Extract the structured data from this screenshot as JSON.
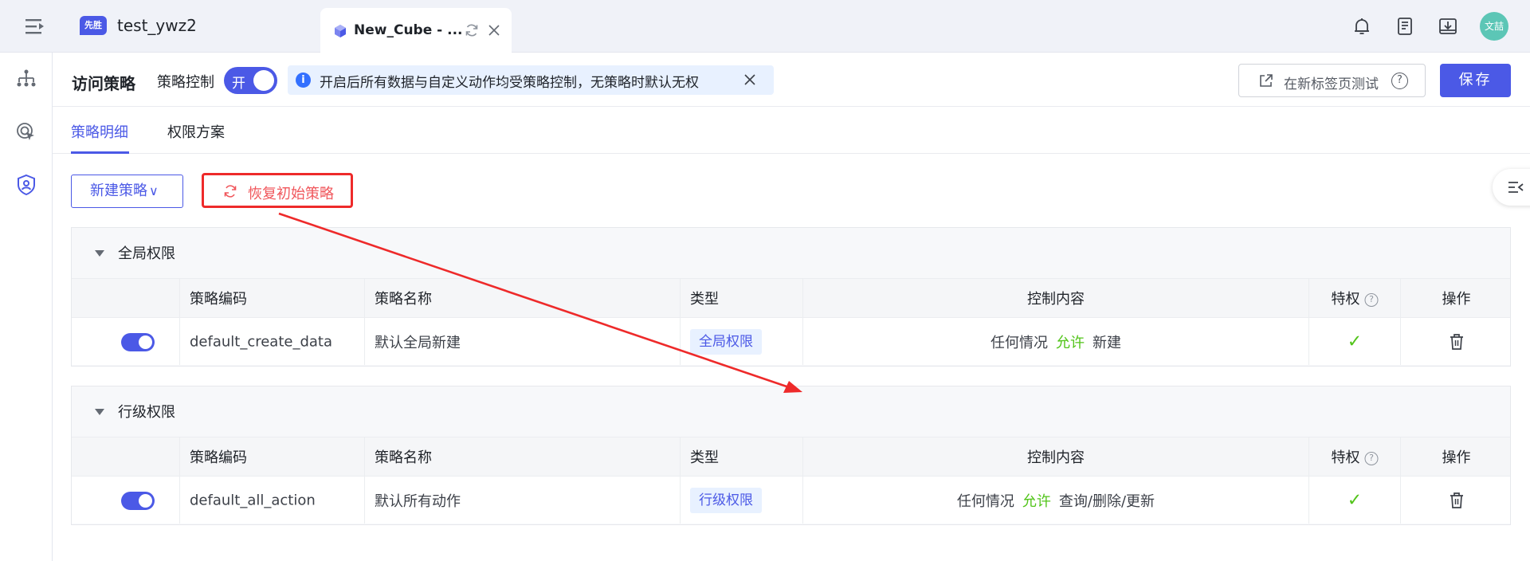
{
  "topbar": {
    "brand_badge": "先胜",
    "app_name": "test_ywz2",
    "tab_title": "New_Cube - ...",
    "avatar_text": "文喆"
  },
  "header": {
    "page_title": "访问策略",
    "policy_control_label": "策略控制",
    "toggle_text": "开",
    "info_text": "开启后所有数据与自定义动作均受策略控制，无策略时默认无权",
    "new_tab_test_label": "在新标签页测试",
    "save_label": "保存"
  },
  "subtabs": [
    "策略明细",
    "权限方案"
  ],
  "actions": {
    "new_policy_label": "新建策略",
    "restore_label": "恢复初始策略"
  },
  "columns": {
    "code": "策略编码",
    "name": "策略名称",
    "type": "类型",
    "content": "控制内容",
    "privilege": "特权",
    "ops": "操作"
  },
  "groups": [
    {
      "title": "全局权限",
      "row": {
        "enabled": true,
        "code": "default_create_data",
        "name": "默认全局新建",
        "type": "全局权限",
        "condition": "任何情况",
        "effect": "允许",
        "action": "新建",
        "privileged": true
      }
    },
    {
      "title": "行级权限",
      "row": {
        "enabled": true,
        "code": "default_all_action",
        "name": "默认所有动作",
        "type": "行级权限",
        "condition": "任何情况",
        "effect": "允许",
        "action": "查询/删除/更新",
        "privileged": true
      }
    }
  ],
  "colors": {
    "accent": "#4b59e6",
    "allow": "#52c41a",
    "annotation": "#ee2a2a"
  }
}
